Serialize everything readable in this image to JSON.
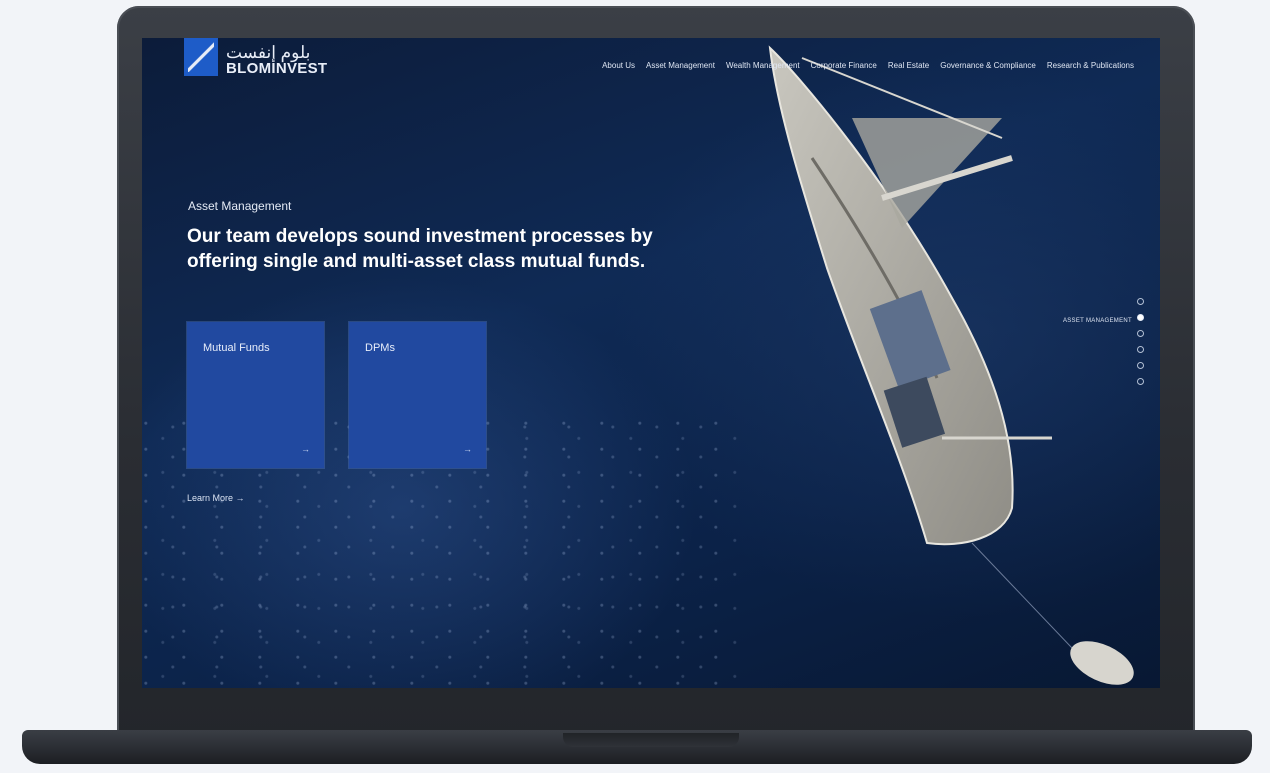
{
  "brand": {
    "arabic_name": "بلوم إنفست",
    "name": "BLOMINVEST",
    "logo_icon": "blom-logo-mark"
  },
  "nav": {
    "items": [
      {
        "label": "About Us"
      },
      {
        "label": "Asset Management"
      },
      {
        "label": "Wealth Management"
      },
      {
        "label": "Corporate Finance"
      },
      {
        "label": "Real Estate"
      },
      {
        "label": "Governance & Compliance"
      },
      {
        "label": "Research & Publications"
      }
    ]
  },
  "hero": {
    "eyebrow": "Asset Management",
    "headline": "Our team develops sound investment processes by offering single and multi-asset class mutual funds.",
    "cards": [
      {
        "label": "Mutual Funds",
        "arrow": "→"
      },
      {
        "label": "DPMs",
        "arrow": "→"
      }
    ],
    "learn_more": "Learn More →"
  },
  "pager": {
    "active_label": "ASSET MANAGEMENT",
    "count": 6,
    "active_index": 1
  },
  "colors": {
    "accent": "#2149a0",
    "background": "#0f2a55"
  }
}
